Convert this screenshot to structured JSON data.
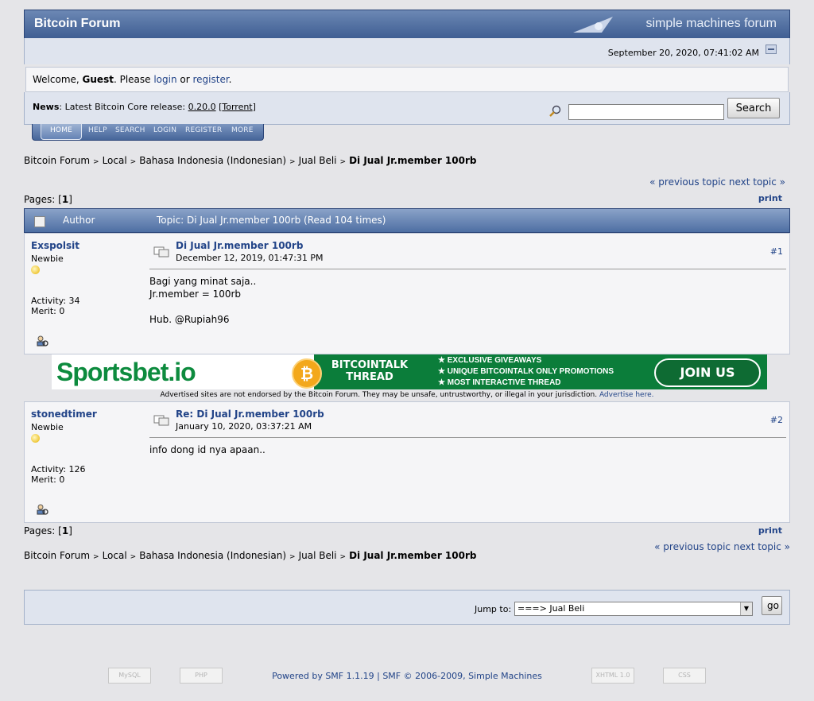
{
  "header": {
    "forum_title": "Bitcoin Forum",
    "smf_logo": "simple machines forum",
    "date": "September 20, 2020, 07:41:02 AM"
  },
  "welcome": {
    "prefix": "Welcome, ",
    "guest": "Guest",
    "mid": ". Please ",
    "login": "login",
    "or": " or ",
    "register": "register",
    "end": "."
  },
  "news": {
    "label": "News",
    "text": ": Latest Bitcoin Core release: ",
    "version": "0.20.0",
    "torrent_open": " [",
    "torrent": "Torrent",
    "torrent_close": "]"
  },
  "search": {
    "button": "Search",
    "value": ""
  },
  "menu": [
    "HOME",
    "HELP",
    "SEARCH",
    "LOGIN",
    "REGISTER",
    "MORE"
  ],
  "breadcrumb": {
    "items": [
      "Bitcoin Forum",
      "Local",
      "Bahasa Indonesia (Indonesian)",
      "Jual Beli"
    ],
    "current": "Di Jual Jr.member 100rb",
    "sep": ">"
  },
  "topic_nav": {
    "prev": "« previous topic",
    "next": "next topic »"
  },
  "pages": {
    "label": "Pages: [",
    "current": "1",
    "end": "]",
    "print": "print"
  },
  "topic_header": {
    "author": "Author",
    "topic": "Topic: Di Jual Jr.member 100rb  (Read 104 times)"
  },
  "posts": [
    {
      "author": "Exspolsit",
      "rank": "Newbie",
      "activity": "Activity: 34",
      "merit": "Merit: 0",
      "title": "Di Jual Jr.member 100rb",
      "date": "December 12, 2019, 01:47:31 PM",
      "number": "#1",
      "body": [
        "Bagi yang minat saja..",
        "Jr.member = 100rb",
        "",
        "Hub. @Rupiah96"
      ]
    },
    {
      "author": "stonedtimer",
      "rank": "Newbie",
      "activity": "Activity: 126",
      "merit": "Merit: 0",
      "title": "Re: Di Jual Jr.member 100rb",
      "date": "January 10, 2020, 03:37:21 AM",
      "number": "#2",
      "body": [
        "info dong id nya apaan.."
      ]
    }
  ],
  "ad": {
    "brand": "Sportsbet.io",
    "thread": "BITCOINTALK THREAD",
    "items": [
      "★ EXCLUSIVE GIVEAWAYS",
      "★ UNIQUE BITCOINTALK ONLY PROMOTIONS",
      "★ MOST INTERACTIVE THREAD"
    ],
    "join": "JOIN US",
    "coin": "₿"
  },
  "disclaimer": {
    "text": "Advertised sites are not endorsed by the Bitcoin  Forum. They may be unsafe, untrustworthy, or illegal in your jurisdiction. ",
    "link": "Advertise here."
  },
  "jump": {
    "label": "Jump to:",
    "selected": "===> Jual Beli",
    "go": "go"
  },
  "footer": {
    "powered": "Powered by SMF 1.1.19",
    "sep": " | ",
    "copyright": "SMF © 2006-2009, Simple Machines",
    "badges": [
      "MySQL",
      "PHP",
      "XHTML 1.0",
      "CSS"
    ]
  }
}
